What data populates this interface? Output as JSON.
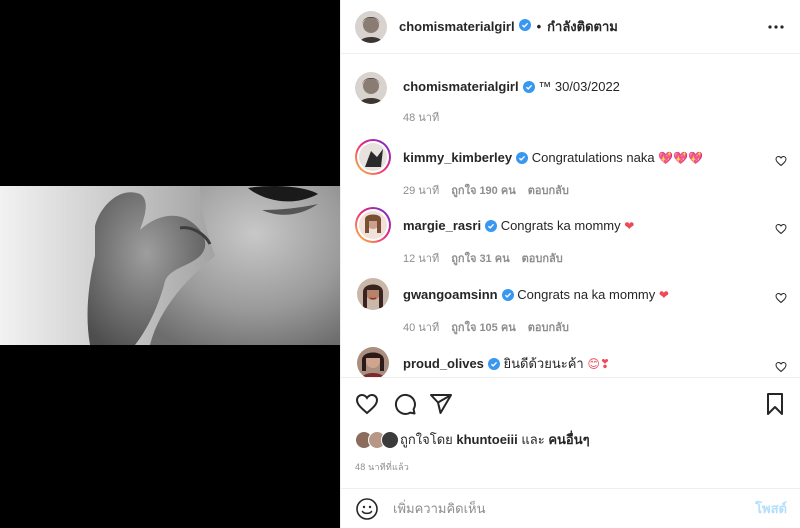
{
  "post_author": {
    "username": "chomismaterialgirl",
    "follow_status": "กำลังติดตาม"
  },
  "caption": {
    "username": "chomismaterialgirl",
    "text": "™ 30/03/2022",
    "time": "48 นาที"
  },
  "comments": [
    {
      "username": "kimmy_kimberley",
      "text": "Congratulations naka",
      "emoji": "💖💖💖",
      "time": "29 นาที",
      "likes": "ถูกใจ 190 คน",
      "reply": "ตอบกลับ"
    },
    {
      "username": "margie_rasri",
      "text": "Congrats ka mommy",
      "emoji": "❤",
      "time": "12 นาที",
      "likes": "ถูกใจ 31 คน",
      "reply": "ตอบกลับ"
    },
    {
      "username": "gwangoamsinn",
      "text": "Congrats na ka mommy",
      "emoji": "❤",
      "time": "40 นาที",
      "likes": "ถูกใจ 105 คน",
      "reply": "ตอบกลับ"
    },
    {
      "username": "proud_olives",
      "text": "ยินดีด้วยนะค้า",
      "emoji": "😊❣",
      "time": "",
      "likes": "",
      "reply": ""
    }
  ],
  "liked_by": {
    "prefix": "ถูกใจโดย",
    "user": "khuntoeiii",
    "conj": "และ",
    "others": "คนอื่นๆ"
  },
  "post_time": "48 นาทีที่แล้ว",
  "add_comment": {
    "placeholder": "เพิ่มความคิดเห็น",
    "post_label": "โพสต์"
  },
  "icons": {
    "verified": "verified-badge-icon",
    "more": "more-options-icon",
    "like": "heart-icon",
    "comment": "comment-icon",
    "share": "share-icon",
    "save": "bookmark-icon",
    "emoji": "emoji-icon"
  },
  "colors": {
    "verified_blue": "#3897f0",
    "post_button": "#b2dffc",
    "heart_red": "#ed4956"
  }
}
